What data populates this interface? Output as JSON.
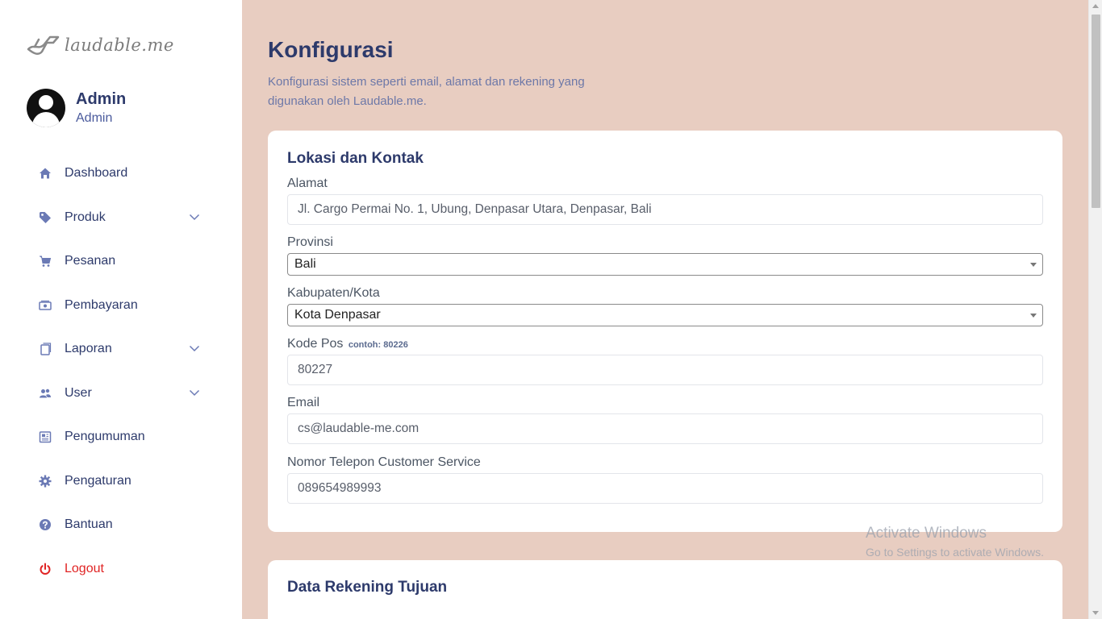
{
  "brand": {
    "logo_text": "laudable.me"
  },
  "profile": {
    "name": "Admin",
    "role": "Admin"
  },
  "sidebar": {
    "items": [
      {
        "label": "Dashboard",
        "icon": "home-icon"
      },
      {
        "label": "Produk",
        "icon": "tag-icon"
      },
      {
        "label": "Pesanan",
        "icon": "cart-icon"
      },
      {
        "label": "Pembayaran",
        "icon": "cash-icon"
      },
      {
        "label": "Laporan",
        "icon": "document-icon"
      },
      {
        "label": "User",
        "icon": "users-icon"
      },
      {
        "label": "Pengumuman",
        "icon": "newspaper-icon"
      },
      {
        "label": "Pengaturan",
        "icon": "gear-icon"
      },
      {
        "label": "Bantuan",
        "icon": "help-icon"
      },
      {
        "label": "Logout",
        "icon": "power-icon"
      }
    ]
  },
  "header": {
    "title": "Konfigurasi",
    "description": "Konfigurasi sistem seperti email, alamat dan rekening yang digunakan oleh Laudable.me."
  },
  "location_card": {
    "title": "Lokasi dan Kontak",
    "address": {
      "label": "Alamat",
      "value": "Jl. Cargo Permai No. 1, Ubung, Denpasar Utara, Denpasar, Bali"
    },
    "province": {
      "label": "Provinsi",
      "selected": "Bali"
    },
    "city": {
      "label": "Kabupaten/Kota",
      "selected": "Kota Denpasar"
    },
    "postal_code": {
      "label": "Kode Pos",
      "hint": "contoh: 80226",
      "value": "80227"
    },
    "email": {
      "label": "Email",
      "value": "cs@laudable-me.com"
    },
    "phone": {
      "label": "Nomor Telepon Customer Service",
      "value": "089654989993"
    }
  },
  "bank_card": {
    "title": "Data Rekening Tujuan"
  },
  "watermark": {
    "title": "Activate Windows",
    "subtitle": "Go to Settings to activate Windows."
  },
  "colors": {
    "background": "#e8cdc1",
    "primary_text": "#2d3a6b",
    "icon": "#6b7ab5",
    "logout": "#e02424"
  }
}
